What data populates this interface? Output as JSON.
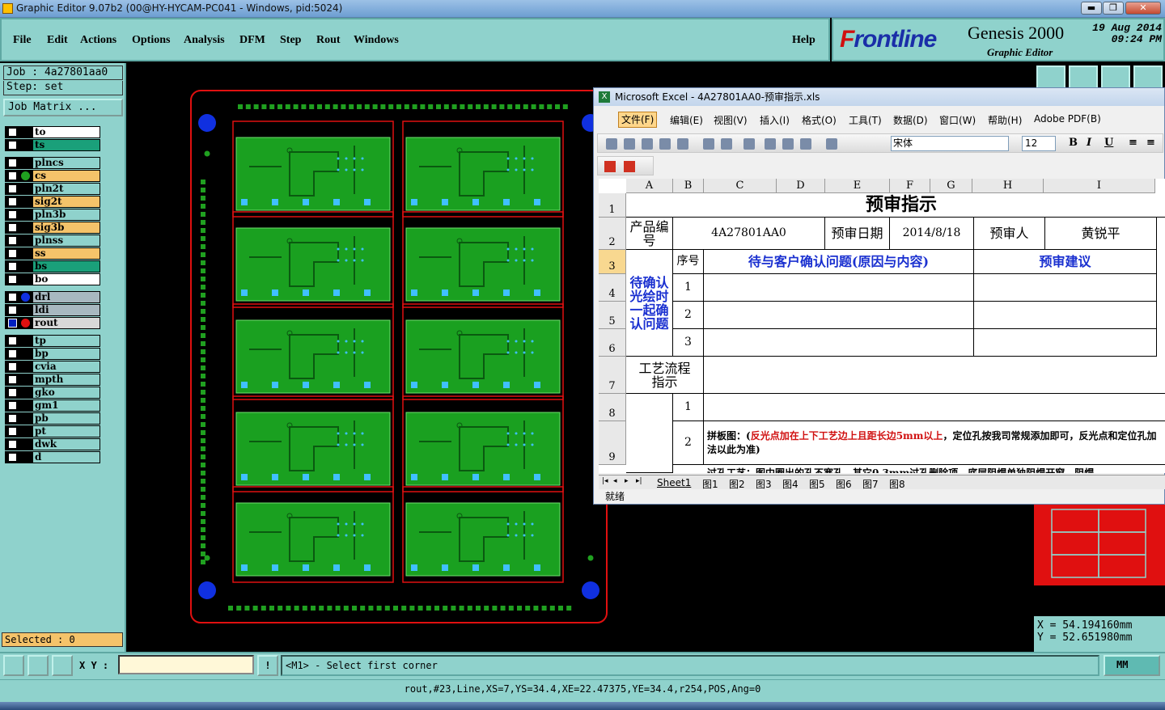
{
  "window": {
    "title": "Graphic Editor 9.07b2 (00@HY-HYCAM-PC041 - Windows, pid:5024)",
    "min": "▬",
    "max": "❐",
    "close": "✕"
  },
  "menu": {
    "file": "File",
    "edit": "Edit",
    "actions": "Actions",
    "options": "Options",
    "analysis": "Analysis",
    "dfm": "DFM",
    "step": "Step",
    "rout": "Rout",
    "windows": "Windows",
    "help": "Help"
  },
  "brand": {
    "logo_f": "F",
    "logo_rest": "rontline",
    "product": "Genesis 2000",
    "subtitle": "Graphic Editor",
    "date": "19 Aug 2014",
    "time": "09:24 PM"
  },
  "job": {
    "job_line": "Job : 4a27801aa0",
    "step_line": "Step: set",
    "matrix_button": "Job Matrix ..."
  },
  "layers": [
    {
      "name": "to",
      "color": "#ffffff",
      "checked": false,
      "dot": ""
    },
    {
      "name": "ts",
      "color": "#1aa07a",
      "checked": false,
      "dot": ""
    },
    {
      "name": "plncs",
      "color": "#8fd2cc",
      "checked": false,
      "dot": ""
    },
    {
      "name": "cs",
      "color": "#f5c36a",
      "checked": false,
      "dot": "#20a020"
    },
    {
      "name": "pln2t",
      "color": "#8fd2cc",
      "checked": false,
      "dot": ""
    },
    {
      "name": "sig2t",
      "color": "#f5c36a",
      "checked": false,
      "dot": ""
    },
    {
      "name": "pln3b",
      "color": "#8fd2cc",
      "checked": false,
      "dot": ""
    },
    {
      "name": "sig3b",
      "color": "#f5c36a",
      "checked": false,
      "dot": ""
    },
    {
      "name": "plnss",
      "color": "#8fd2cc",
      "checked": false,
      "dot": ""
    },
    {
      "name": "ss",
      "color": "#f5c36a",
      "checked": false,
      "dot": ""
    },
    {
      "name": "bs",
      "color": "#1aa07a",
      "checked": false,
      "dot": ""
    },
    {
      "name": "bo",
      "color": "#ffffff",
      "checked": false,
      "dot": ""
    },
    {
      "name": "drl",
      "color": "#a8b8c0",
      "checked": false,
      "dot": "#1030e0"
    },
    {
      "name": "ldi",
      "color": "#a8b8c0",
      "checked": false,
      "dot": ""
    },
    {
      "name": "rout",
      "color": "#d8d8d8",
      "checked": true,
      "dot": "#e01010"
    },
    {
      "name": "tp",
      "color": "#8fd2cc",
      "checked": false,
      "dot": ""
    },
    {
      "name": "bp",
      "color": "#8fd2cc",
      "checked": false,
      "dot": ""
    },
    {
      "name": "cvia",
      "color": "#8fd2cc",
      "checked": false,
      "dot": ""
    },
    {
      "name": "mpth",
      "color": "#8fd2cc",
      "checked": false,
      "dot": ""
    },
    {
      "name": "gko",
      "color": "#8fd2cc",
      "checked": false,
      "dot": ""
    },
    {
      "name": "gm1",
      "color": "#8fd2cc",
      "checked": false,
      "dot": ""
    },
    {
      "name": "pb",
      "color": "#8fd2cc",
      "checked": false,
      "dot": ""
    },
    {
      "name": "pt",
      "color": "#8fd2cc",
      "checked": false,
      "dot": ""
    },
    {
      "name": "dwk",
      "color": "#8fd2cc",
      "checked": false,
      "dot": ""
    },
    {
      "name": "d",
      "color": "#8fd2cc",
      "checked": false,
      "dot": ""
    }
  ],
  "selected": "Selected : 0",
  "xy_label": "X Y :",
  "xy_value": "",
  "message": "<M1> - Select first corner",
  "units": "MM",
  "status": "rout,#23,Line,XS=7,YS=34.4,XE=22.47375,YE=34.4,r254,POS,Ang=0",
  "coords": {
    "x": "X  =  54.194160mm",
    "y": "Y  =  52.651980mm"
  },
  "excel": {
    "title": "Microsoft Excel - 4A27801AA0-预审指示.xls",
    "menu": [
      "文件(F)",
      "编辑(E)",
      "视图(V)",
      "插入(I)",
      "格式(O)",
      "工具(T)",
      "数据(D)",
      "窗口(W)",
      "帮助(H)",
      "Adobe PDF(B)"
    ],
    "font": "宋体",
    "size": "12",
    "cols": [
      "A",
      "B",
      "C",
      "D",
      "E",
      "F",
      "G",
      "H",
      "I"
    ],
    "rows": [
      "1",
      "2",
      "3",
      "4",
      "5",
      "6",
      "7",
      "8",
      "9"
    ],
    "sheet_title": "预审指示",
    "product_label": "产品编号",
    "product_no": "4A27801AA0",
    "date_label": "预审日期",
    "date": "2014/8/18",
    "reviewer_label": "预审人",
    "reviewer": "黄锐平",
    "seq_label": "序号",
    "issue_header": "待与客户确认问题(原因与内容)",
    "suggest_header": "预审建议",
    "confirm_label": "待确认光绘时一起确认问题",
    "n1": "1",
    "n2": "2",
    "n3": "3",
    "process_label": "工艺流程指示",
    "p1": "1",
    "p2": "2",
    "note_prefix": "拼板图：(",
    "note_red": "反光点加在上下工艺边上且距长边5mm以上",
    "note_suffix": "，定位孔按我司常规添加即可，反光点和定位孔加法以此为准)",
    "row10_partial": "过孔工艺：图中圈出的孔不塞孔，其它0.3mm过孔删除项，底层阻焊单独阻焊开窗，阻焊",
    "sheets": [
      "Sheet1",
      "图1",
      "图2",
      "图3",
      "图4",
      "图5",
      "图6",
      "图7",
      "图8"
    ],
    "ready": "就绪"
  }
}
